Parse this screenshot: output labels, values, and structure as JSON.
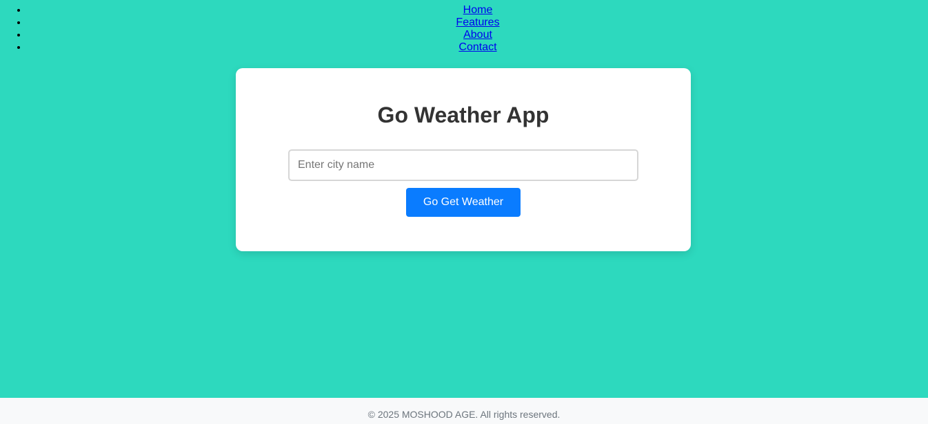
{
  "nav": {
    "items": [
      {
        "label": "Home"
      },
      {
        "label": "Features"
      },
      {
        "label": "About"
      },
      {
        "label": "Contact"
      }
    ]
  },
  "main": {
    "title": "Go Weather App",
    "city_input": {
      "placeholder": "Enter city name",
      "value": ""
    },
    "submit_label": "Go Get Weather"
  },
  "footer": {
    "text": "© 2025 MOSHOOD AGE. All rights reserved."
  },
  "colors": {
    "background": "#2dd9be",
    "card": "#ffffff",
    "button": "#0a7cff",
    "footer_background": "#f8f9fa",
    "link": "#0000ee"
  }
}
